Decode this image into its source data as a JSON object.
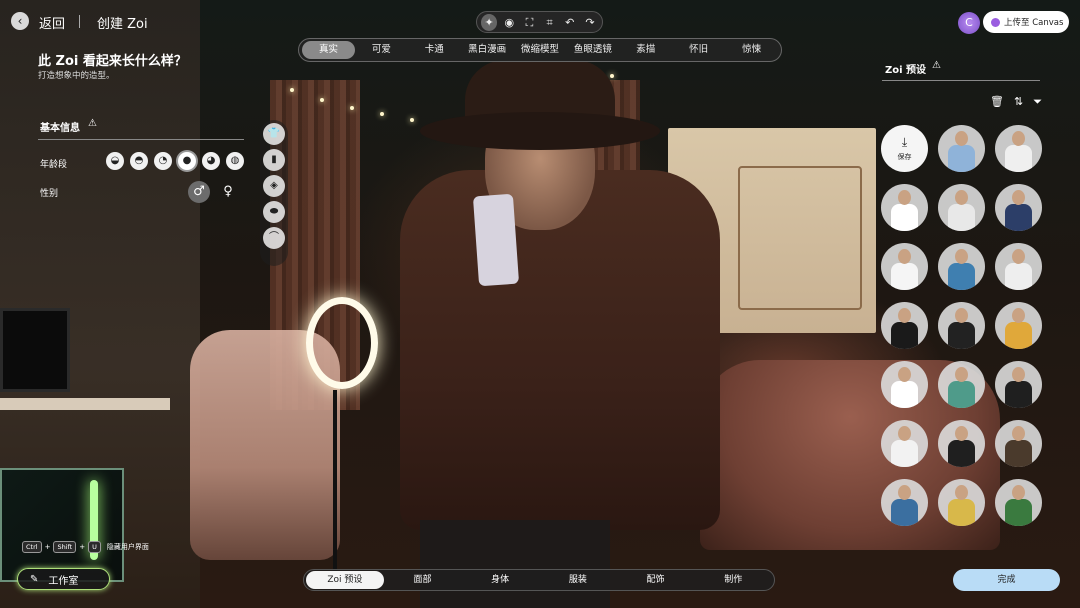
{
  "header": {
    "back_label": "返回",
    "page_title": "创建 Zoi",
    "tools": [
      "sparkle-icon",
      "camera-icon",
      "frame-icon",
      "focus-icon",
      "undo-icon",
      "redo-icon"
    ],
    "account_initial": "C",
    "upload_label": "上传至 Canvas"
  },
  "style_filters": {
    "items": [
      "真实",
      "可爱",
      "卡通",
      "黑白漫画",
      "微缩模型",
      "鱼眼透镜",
      "素描",
      "怀旧",
      "惊悚"
    ],
    "active": "真实"
  },
  "left_panel": {
    "question": "此 Zoi 看起来长什么样？",
    "subtitle": "打造想象中的造型。",
    "basic_info_title": "基本信息",
    "age_label": "年龄段",
    "age_options": [
      "baby-icon",
      "child-icon",
      "teen-icon",
      "adult-icon",
      "middle-age-icon",
      "elder-icon"
    ],
    "age_selected": 3,
    "gender_label": "性别",
    "gender_male": "♂",
    "gender_female": "♀"
  },
  "category_strip": [
    "top-icon",
    "pants-icon",
    "outfit-icon",
    "shoes-icon",
    "hat-icon"
  ],
  "shortcut": {
    "keys": [
      "Ctrl",
      "Shift",
      "U"
    ],
    "plus": "+",
    "label": "隐藏用户界面"
  },
  "studio_label": "工作室",
  "right_panel": {
    "title": "Zoi 预设",
    "tools": [
      "trash-icon",
      "sort-icon",
      "filter-icon"
    ],
    "save_label": "保存",
    "preset_colors": [
      "#8fb3d9",
      "#efefef",
      "#ffffff",
      "#e8e8e8",
      "#2c3e68",
      "#f5f5f5",
      "#3f7fb0",
      "#eeeeee",
      "#1a1a1a",
      "#222222",
      "#e0a83a",
      "#ffffff",
      "#4f9b8a",
      "#1f1f1f",
      "#f2f2f2",
      "#1f1f1f",
      "#4a3a2c",
      "#3b6fa0",
      "#d8b84a",
      "#3a7a3f"
    ]
  },
  "bottom_nav": {
    "items": [
      "Zoi 预设",
      "面部",
      "身体",
      "服装",
      "配饰",
      "制作"
    ],
    "active": "Zoi 预设"
  },
  "done_label": "完成"
}
